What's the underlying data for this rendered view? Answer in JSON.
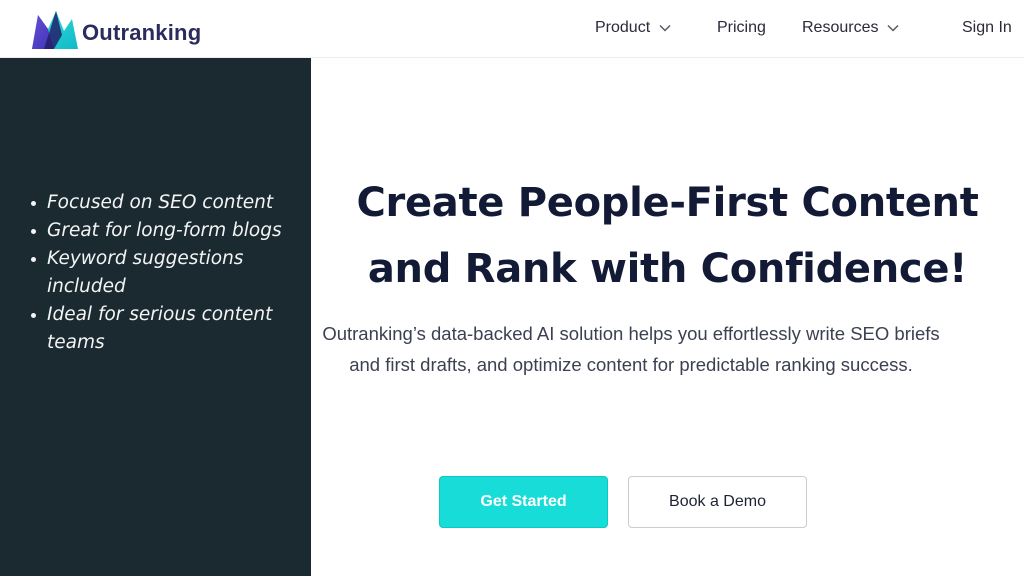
{
  "brand": {
    "name": "Outranking",
    "logo_icon": "outranking-mountain-logo",
    "colors": {
      "primary": "#18dcd8",
      "dark": "#1b2a30",
      "logo_purple": "#4b3fc7",
      "text_dark": "#121a36"
    }
  },
  "nav": {
    "items": [
      {
        "label": "Product",
        "has_dropdown": true,
        "icon": "chevron-down-icon"
      },
      {
        "label": "Pricing",
        "has_dropdown": false
      },
      {
        "label": "Resources",
        "has_dropdown": true,
        "icon": "chevron-down-icon"
      }
    ],
    "signin_label": "Sign In"
  },
  "sidebar": {
    "features": [
      "Focused on SEO content",
      "Great for long-form blogs",
      "Keyword suggestions included",
      "Ideal for serious content teams"
    ]
  },
  "hero": {
    "title_line1": "Create People-First Content",
    "title_line2": "and Rank with Confidence!",
    "subtitle": "Outranking’s data-backed AI solution helps you effortlessly write SEO briefs and first drafts, and optimize content for predictable ranking success.",
    "cta_primary": "Get Started",
    "cta_secondary": "Book a Demo"
  }
}
